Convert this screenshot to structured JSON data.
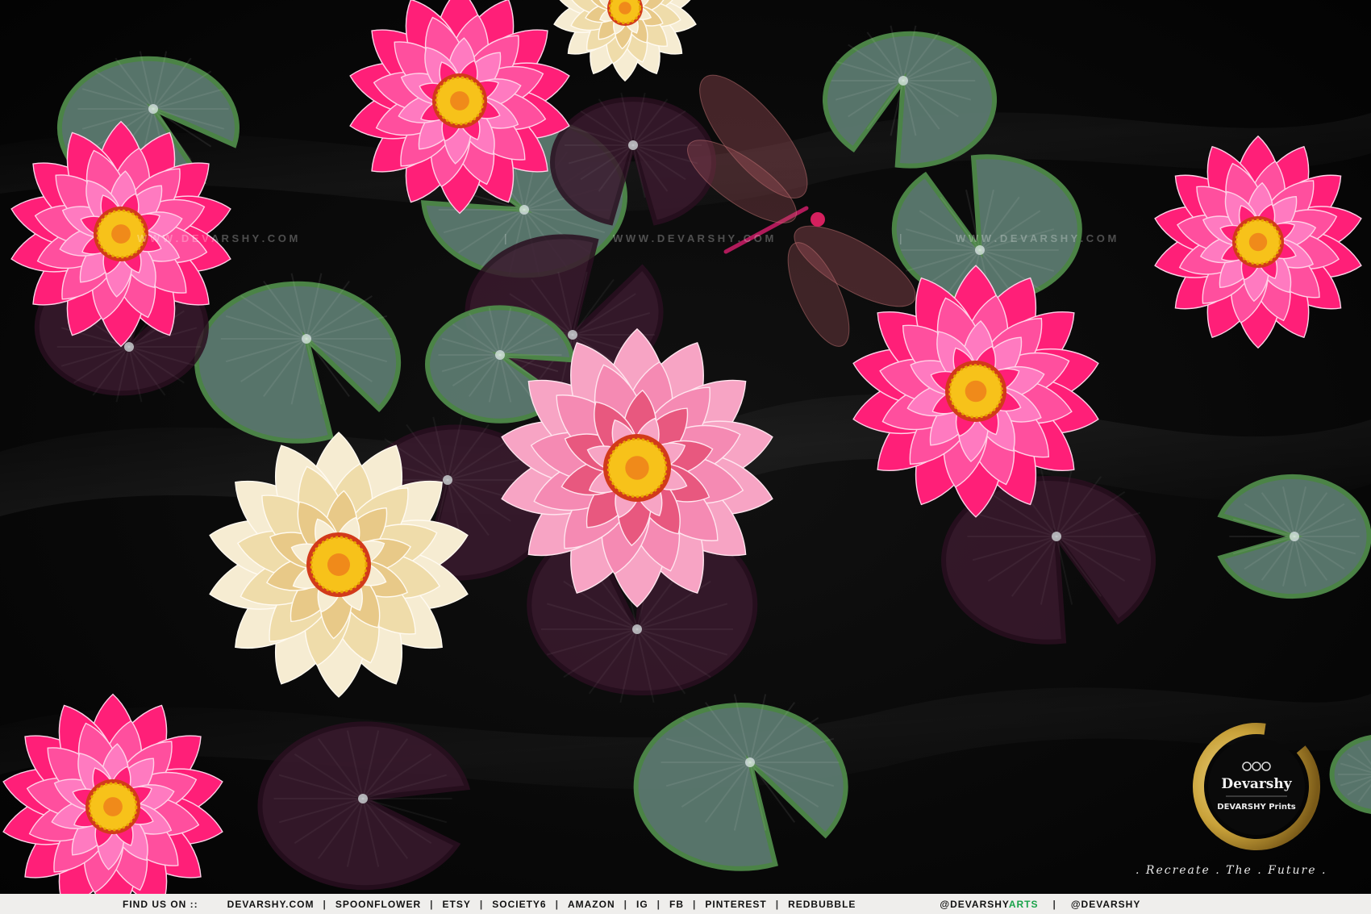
{
  "watermark": {
    "text_1": "W W W . D E V A R S H Y . C O M",
    "text_2": "W W W . D E V A R S H Y . C O M",
    "text_3": "W W W . D E V A R S H Y . C O M"
  },
  "footer": {
    "lead": "FIND US ON ::",
    "links": [
      "DEVARSHY.COM",
      "SPOONFLOWER",
      "ETSY",
      "SOCIETY6",
      "AMAZON",
      "IG",
      "FB",
      "PINTEREST",
      "REDBUBBLE"
    ],
    "handle_1_main": "@DEVARSHY",
    "handle_1_accent": "ARTS",
    "handle_2": "@DEVARSHY"
  },
  "logo": {
    "brand_name": "Devarshy",
    "sub_brand": "DEVARSHY Prints"
  },
  "tagline": ". Recreate . The . Future .",
  "colors": {
    "background": "#000000",
    "magenta_lotus": "#ff1f78",
    "pink_lotus": "#f7a4c4",
    "cream_lotus": "#f6ecd2",
    "lily_pad_green": "#5c7a70",
    "lily_pad_plum": "#3a1a2e",
    "gold_ring": "#c9a23a",
    "footer_bg": "#efeeec",
    "footer_accent": "#1aa34a"
  }
}
